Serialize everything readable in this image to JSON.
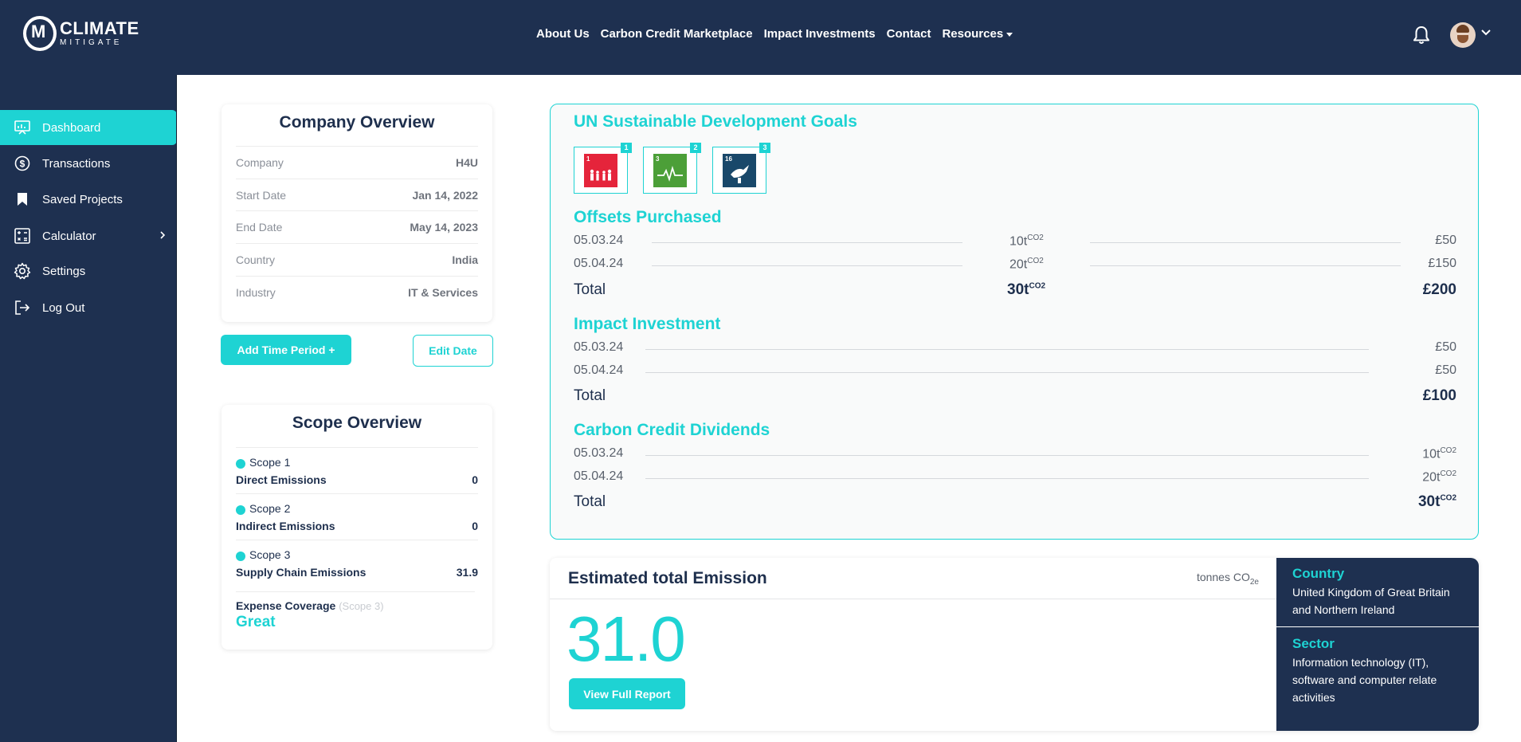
{
  "app": {
    "logo_line1": "CLIMATE",
    "logo_line2": "MITIGATE"
  },
  "nav": {
    "items": [
      "About Us",
      "Carbon Credit Marketplace",
      "Impact Investments",
      "Contact",
      "Resources"
    ]
  },
  "sidebar": {
    "items": [
      {
        "label": "Dashboard",
        "icon": "dashboard-icon"
      },
      {
        "label": "Transactions",
        "icon": "dollar-icon"
      },
      {
        "label": "Saved Projects",
        "icon": "bookmark-icon"
      },
      {
        "label": "Calculator",
        "icon": "calculator-icon"
      },
      {
        "label": "Settings",
        "icon": "gear-icon"
      },
      {
        "label": "Log Out",
        "icon": "logout-icon"
      }
    ]
  },
  "company_overview": {
    "title": "Company Overview",
    "rows": [
      {
        "key": "Company",
        "value": "H4U"
      },
      {
        "key": "Start Date",
        "value": "Jan 14, 2022"
      },
      {
        "key": "End Date",
        "value": "May 14, 2023"
      },
      {
        "key": "Country",
        "value": "India"
      },
      {
        "key": "Industry",
        "value": "IT & Services"
      }
    ],
    "add_button": "Add Time Period +",
    "edit_button": "Edit Date"
  },
  "scope_overview": {
    "title": "Scope Overview",
    "scopes": [
      {
        "name": "Scope 1",
        "desc": "Direct Emissions",
        "value": "0"
      },
      {
        "name": "Scope 2",
        "desc": "Indirect Emissions",
        "value": "0"
      },
      {
        "name": "Scope 3",
        "desc": "Supply Chain Emissions",
        "value": "31.9"
      }
    ],
    "coverage_label": "Expense Coverage",
    "coverage_scope": "(Scope 3)",
    "coverage_value": "Great"
  },
  "sdg": {
    "title": "UN Sustainable Development Goals",
    "goals": [
      {
        "badge": "1",
        "color": "#e5243b"
      },
      {
        "badge": "2",
        "color": "#4c9f38"
      },
      {
        "badge": "3",
        "color": "#19486a"
      }
    ]
  },
  "offsets": {
    "title": "Offsets Purchased",
    "rows": [
      {
        "date": "05.03.24",
        "tonnes": "10t",
        "price": "£50"
      },
      {
        "date": "05.04.24",
        "tonnes": "20t",
        "price": "£150"
      }
    ],
    "total_label": "Total",
    "total_tonnes": "30t",
    "total_price": "£200",
    "unit_sup": "CO2"
  },
  "impact": {
    "title": "Impact Investment",
    "rows": [
      {
        "date": "05.03.24",
        "price": "£50"
      },
      {
        "date": "05.04.24",
        "price": "£50"
      }
    ],
    "total_label": "Total",
    "total_price": "£100"
  },
  "dividends": {
    "title": "Carbon Credit Dividends",
    "rows": [
      {
        "date": "05.03.24",
        "tonnes": "10t"
      },
      {
        "date": "05.04.24",
        "tonnes": "20t"
      }
    ],
    "total_label": "Total",
    "total_tonnes": "30t",
    "unit_sup": "CO2"
  },
  "emission": {
    "title": "Estimated total Emission",
    "unit_main": "tonnes CO",
    "unit_sub": "2e",
    "value": "31.0",
    "report_button": "View Full Report"
  },
  "info": {
    "country_label": "Country",
    "country_value": "United Kingdom of Great Britain and Northern Ireland",
    "sector_label": "Sector",
    "sector_value": "Information technology (IT), software and computer relate activities"
  },
  "colors": {
    "navy": "#1e3050",
    "accent": "#1ed3d3"
  }
}
